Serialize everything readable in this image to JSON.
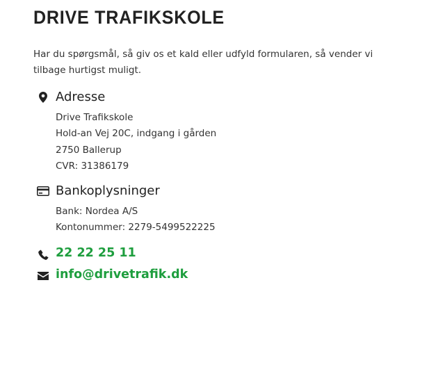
{
  "title": "DRIVE TRAFIKSKOLE",
  "intro": "Har du spørgsmål, så giv os et kald eller udfyld formularen, så vender vi tilbage hurtigst muligt.",
  "address": {
    "icon": "map-pin-icon",
    "heading": "Adresse",
    "lines": [
      "Drive Trafikskole",
      "Hold-an Vej 20C, indgang i gården",
      "2750 Ballerup",
      "CVR: 31386179"
    ]
  },
  "bank": {
    "icon": "credit-card-icon",
    "heading": "Bankoplysninger",
    "lines": [
      "Bank: Nordea A/S",
      "Kontonummer: 2279-5499522225"
    ]
  },
  "contact": {
    "phone": {
      "icon": "phone-icon",
      "label": "22 22 25 11"
    },
    "email": {
      "icon": "envelope-icon",
      "label": "info@drivetrafik.dk"
    }
  },
  "colors": {
    "link": "#1e9e3e",
    "heading": "#222222",
    "text": "#333333",
    "icon": "#222222"
  }
}
